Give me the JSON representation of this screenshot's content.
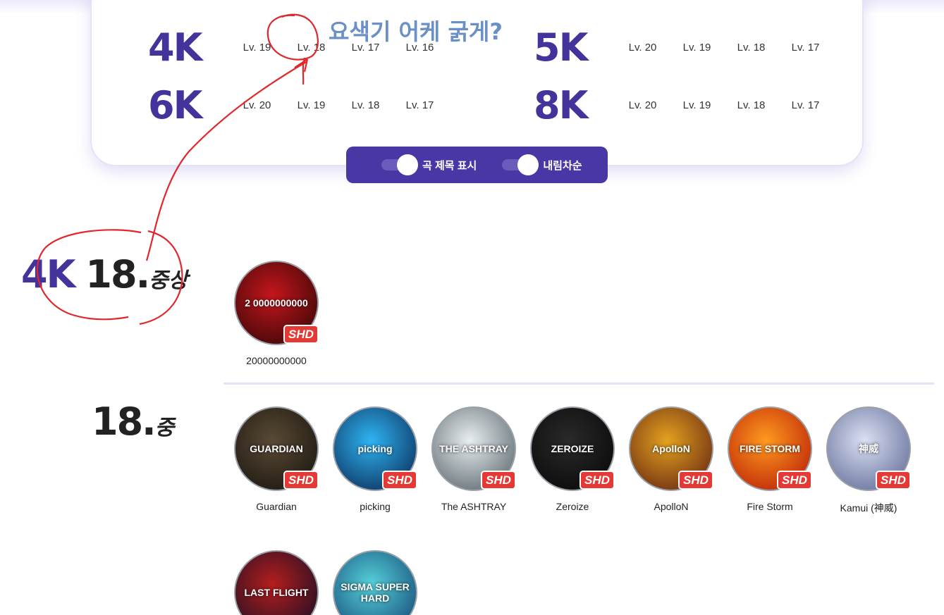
{
  "level_grid": [
    {
      "key": "4K",
      "levels": [
        "Lv. 19",
        "Lv. 18",
        "Lv. 17",
        "Lv. 16"
      ]
    },
    {
      "key": "5K",
      "levels": [
        "Lv. 20",
        "Lv. 19",
        "Lv. 18",
        "Lv. 17"
      ]
    },
    {
      "key": "6K",
      "levels": [
        "Lv. 20",
        "Lv. 19",
        "Lv. 18",
        "Lv. 17"
      ]
    },
    {
      "key": "8K",
      "levels": [
        "Lv. 20",
        "Lv. 19",
        "Lv. 18",
        "Lv. 17"
      ]
    }
  ],
  "options": {
    "show_title_label": "곡 제목 표시",
    "show_title_on": true,
    "descending_label": "내림차순",
    "descending_on": true
  },
  "sections": [
    {
      "key": "4K",
      "level": "18.",
      "sublevel": "중상",
      "songs": [
        {
          "title": "20000000000",
          "badge": "SHD",
          "art": "2 0000000000",
          "color_a": "#c4161c",
          "color_b": "#2a0505"
        }
      ]
    },
    {
      "level": "18.",
      "sublevel": "중",
      "songs": [
        {
          "title": "Guardian",
          "badge": "SHD",
          "art": "GUARDIAN",
          "color_a": "#5a4a35",
          "color_b": "#14110c"
        },
        {
          "title": "picking",
          "badge": "SHD",
          "art": "picking",
          "color_a": "#2fb4f2",
          "color_b": "#07204a"
        },
        {
          "title": "The ASHTRAY",
          "badge": "SHD",
          "art": "THE ASHTRAY",
          "color_a": "#e9eef0",
          "color_b": "#4c5a60"
        },
        {
          "title": "Zeroize",
          "badge": "SHD",
          "art": "ZEROIZE",
          "color_a": "#2a2a2a",
          "color_b": "#050505"
        },
        {
          "title": "ApolloN",
          "badge": "SHD",
          "art": "ApolloN",
          "color_a": "#e4a21f",
          "color_b": "#5a1a10"
        },
        {
          "title": "Fire Storm",
          "badge": "SHD",
          "art": "FIRE STORM",
          "color_a": "#ff9a1e",
          "color_b": "#b31205"
        },
        {
          "title": "Kamui (神威)",
          "badge": "SHD",
          "art": "神威",
          "color_a": "#dbe0f2",
          "color_b": "#55608f"
        },
        {
          "title": "",
          "badge": "",
          "art": "LAST FLIGHT",
          "color_a": "#b41e1e",
          "color_b": "#0b0d25"
        },
        {
          "title": "",
          "badge": "",
          "art": "SIGMA SUPER HARD",
          "color_a": "#56d1d9",
          "color_b": "#0e3c6e"
        }
      ]
    }
  ],
  "annotation": {
    "text": "요색기 어케 굵게?",
    "color": "#6b8fc7",
    "pen_color": "#e0282c"
  },
  "colors": {
    "accent": "#4a37a6",
    "key_label": "#44339b",
    "badge": "#e53935"
  }
}
